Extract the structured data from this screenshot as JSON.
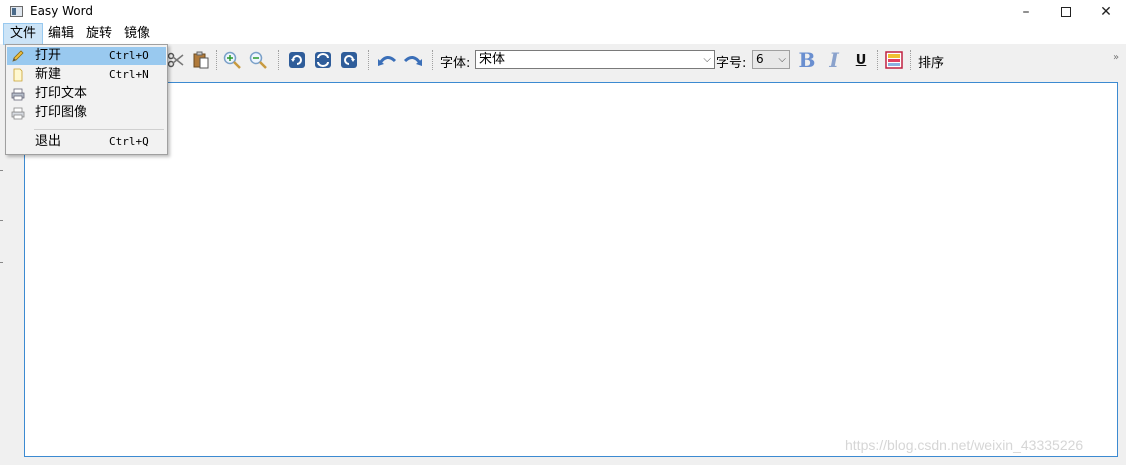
{
  "window": {
    "title": "Easy Word",
    "minimize": "–",
    "close": "✕"
  },
  "menubar": {
    "items": [
      "文件",
      "编辑",
      "旋转",
      "镜像"
    ]
  },
  "file_menu": {
    "items": [
      {
        "label": "打开",
        "shortcut": "Ctrl+O"
      },
      {
        "label": "新建",
        "shortcut": "Ctrl+N"
      },
      {
        "label": "打印文本",
        "shortcut": ""
      },
      {
        "label": "打印图像",
        "shortcut": ""
      },
      {
        "label": "退出",
        "shortcut": "Ctrl+Q"
      }
    ]
  },
  "toolbar": {
    "font_label": "字体:",
    "font_value": "宋体",
    "size_label": "字号:",
    "size_value": "6",
    "bold": "B",
    "italic": "I",
    "underline": "U",
    "sort_label": "排序",
    "overflow": "»"
  },
  "watermark": "https://blog.csdn.net/weixin_43335226",
  "colors": {
    "accent": "#3c8ad1",
    "menu_highlight": "#99c9ef"
  }
}
